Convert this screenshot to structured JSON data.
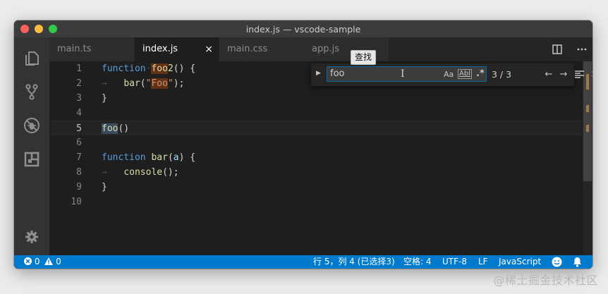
{
  "window": {
    "title": "index.js — vscode-sample"
  },
  "activity_bar": {
    "items": [
      "files-icon",
      "source-control-icon",
      "debug-icon",
      "extensions-icon"
    ],
    "settings": "gear-icon"
  },
  "tabs": [
    {
      "label": "main.ts",
      "active": false
    },
    {
      "label": "index.js",
      "active": true,
      "close": "×"
    },
    {
      "label": "main.css",
      "active": false
    },
    {
      "label": "app.js",
      "active": false
    }
  ],
  "editor": {
    "line_numbers": [
      "1",
      "2",
      "3",
      "4",
      "5",
      "6",
      "7",
      "8",
      "9",
      "10"
    ],
    "current_line": "5",
    "lines": [
      "function foo2() {",
      "    bar(\"Foo\");",
      "}",
      "",
      "foo()",
      "",
      "function bar(a) {",
      "    console();",
      "}",
      ""
    ]
  },
  "find_widget": {
    "query": "foo",
    "match_case": "Aa",
    "whole_word": "Abl",
    "regex": ".*",
    "count": "3 / 3",
    "prev": "←",
    "next": "→",
    "close": "×"
  },
  "tooltip": "查找",
  "status_bar": {
    "errors": "0",
    "warnings": "0",
    "position": "行 5，列 4 (已选择3)",
    "indent": "空格: 4",
    "encoding": "UTF-8",
    "eol": "LF",
    "language": "JavaScript"
  },
  "watermark": "@稀土掘金技术社区",
  "colors": {
    "status_bar": "#007acc",
    "editor_bg": "#1e1e1e",
    "match_highlight": "#613214",
    "keyword": "#569cd6",
    "function": "#dcdcaa",
    "string": "#ce9178"
  }
}
